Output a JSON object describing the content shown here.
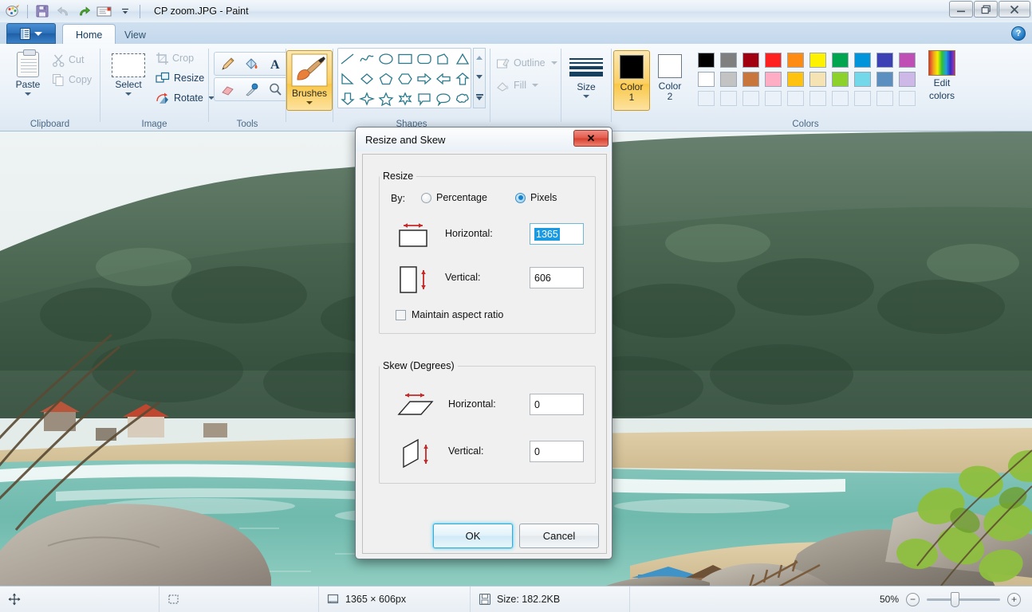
{
  "window": {
    "title": "CP zoom.JPG - Paint",
    "quick_access": [
      {
        "name": "paint-logo-icon",
        "label": "Paint"
      },
      {
        "name": "save-icon",
        "label": "Save"
      },
      {
        "name": "undo-icon",
        "label": "Undo"
      },
      {
        "name": "redo-icon",
        "label": "Redo"
      },
      {
        "name": "email-icon",
        "label": "Send in e-mail"
      },
      {
        "name": "customize-qat-caret-icon",
        "label": "Customize Quick Access Toolbar"
      }
    ],
    "controls": {
      "minimize": "–",
      "restore": "❐",
      "close": "✕"
    },
    "help": "?"
  },
  "tabs": {
    "file_menu_label": "File",
    "items": [
      {
        "label": "Home",
        "active": true
      },
      {
        "label": "View",
        "active": false
      }
    ]
  },
  "ribbon": {
    "groups": [
      {
        "name": "clipboard",
        "label": "Clipboard"
      },
      {
        "name": "image",
        "label": "Image"
      },
      {
        "name": "tools",
        "label": "Tools"
      },
      {
        "name": "brushes",
        "label": ""
      },
      {
        "name": "shapes",
        "label": "Shapes"
      },
      {
        "name": "colors",
        "label": "Colors"
      }
    ],
    "clipboard": {
      "paste": "Paste",
      "cut": "Cut",
      "copy": "Copy"
    },
    "image": {
      "select": "Select",
      "crop": "Crop",
      "resize": "Resize",
      "rotate": "Rotate"
    },
    "tools": {
      "icons": [
        "pencil-icon",
        "fill-bucket-icon",
        "text-icon",
        "eraser-icon",
        "color-picker-icon",
        "magnifier-icon"
      ]
    },
    "brushes": {
      "label": "Brushes"
    },
    "shapes": {
      "glyphs": [
        "line",
        "curve",
        "oval",
        "rectangle",
        "rounded-rectangle",
        "right-triangle",
        "triangle",
        "diagonal-line",
        "diamond",
        "pentagon",
        "hexagon",
        "right-arrow",
        "left-arrow",
        "up-arrow",
        "down-arrow",
        "four-point-star",
        "five-point-star",
        "six-point-star",
        "rounded-callout",
        "oval-callout",
        "cloud-callout"
      ]
    },
    "outline_fill": {
      "outline": "Outline",
      "fill": "Fill"
    },
    "size": {
      "label": "Size"
    },
    "color1": {
      "label_top": "Color",
      "label_bottom": "1",
      "value": "#000000"
    },
    "color2": {
      "label_top": "Color",
      "label_bottom": "2",
      "value": "#ffffff"
    },
    "edit_colors": {
      "label_top": "Edit",
      "label_bottom": "colors"
    },
    "palette": {
      "row1": [
        "#000000",
        "#7f7f7f",
        "#a00010",
        "#ff2020",
        "#ff8c12",
        "#fff200",
        "#00a64f",
        "#0095da",
        "#3b40b5",
        "#c04fb5"
      ],
      "row2": [
        "#ffffff",
        "#c3c3c3",
        "#c8763c",
        "#ffadc4",
        "#ffc20e",
        "#f5e3b3",
        "#8dd22a",
        "#72d8ea",
        "#5b8fc0",
        "#cdb8e8"
      ],
      "row3": [
        "",
        "",
        "",
        "",
        "",
        "",
        "",
        "",
        "",
        ""
      ]
    }
  },
  "dialog": {
    "title": "Resize and Skew",
    "close_label": "✕",
    "resize": {
      "legend": "Resize",
      "by_label": "By:",
      "options": [
        {
          "label": "Percentage",
          "selected": false
        },
        {
          "label": "Pixels",
          "selected": true
        }
      ],
      "horizontal_label": "Horizontal:",
      "horizontal_value": "1365",
      "vertical_label": "Vertical:",
      "vertical_value": "606",
      "maintain_label": "Maintain aspect ratio",
      "maintain_checked": false
    },
    "skew": {
      "legend": "Skew (Degrees)",
      "horizontal_label": "Horizontal:",
      "horizontal_value": "0",
      "vertical_label": "Vertical:",
      "vertical_value": "0"
    },
    "buttons": {
      "ok": "OK",
      "cancel": "Cancel"
    }
  },
  "status": {
    "cursor_icon": "move-cursor-icon",
    "selection_icon": "selection-size-icon",
    "image_size_icon": "image-size-icon",
    "image_size": "1365 × 606px",
    "file_size_icon": "file-size-icon",
    "file_size": "Size: 182.2KB",
    "zoom_level": "50%",
    "zoom_out": "−",
    "zoom_in": "+"
  },
  "canvas": {
    "description": "Tropical beach photograph with jungle hills, turquoise bay, sandy beach and granite boulders"
  }
}
